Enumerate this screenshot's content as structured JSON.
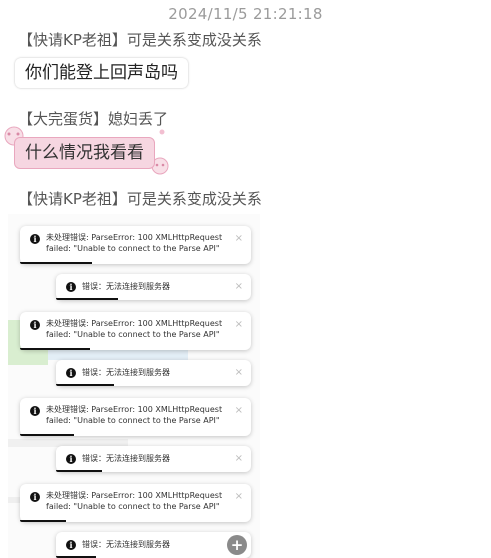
{
  "timestamp": "2024/11/5 21:21:18",
  "messages": [
    {
      "sender": "【快请KP老祖】可是关系变成没关系",
      "text": "你们能登上回声岛吗"
    },
    {
      "sender": "【大完蛋货】媳妇丢了",
      "text": "什么情况我看看"
    },
    {
      "sender": "【快请KP老祖】可是关系变成没关系"
    }
  ],
  "toasts": [
    {
      "line1": "未处理错误: ParseError: 100 XMLHttpRequest",
      "line2": "failed: \"Unable to connect to the Parse API\""
    },
    {
      "line1": "错误：无法连接到服务器"
    },
    {
      "line1": "未处理错误: ParseError: 100 XMLHttpRequest",
      "line2": "failed: \"Unable to connect to the Parse API\""
    },
    {
      "line1": "错误：无法连接到服务器"
    },
    {
      "line1": "未处理错误: ParseError: 100 XMLHttpRequest",
      "line2": "failed: \"Unable to connect to the Parse API\""
    },
    {
      "line1": "错误：无法连接到服务器"
    },
    {
      "line1": "未处理错误: ParseError: 100 XMLHttpRequest",
      "line2": "failed: \"Unable to connect to the Parse API\""
    },
    {
      "line1": "错误：无法连接到服务器"
    }
  ],
  "icons": {
    "info": "info-icon",
    "close": "close-icon",
    "zoom": "zoom-in-icon"
  },
  "glyphs": {
    "info": "i",
    "close": "×",
    "zoom": "+"
  },
  "colors": {
    "timestamp": "#9b9b9b",
    "pink_bubble": "#f6d6e1",
    "pink_border": "#e9a7be"
  }
}
